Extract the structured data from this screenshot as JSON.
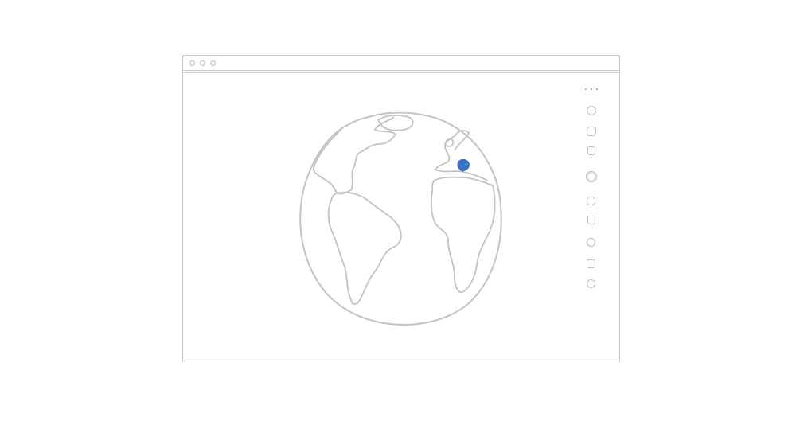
{
  "window": {
    "controls": [
      "close-dot",
      "minimize-dot",
      "maximize-dot"
    ]
  },
  "globe": {
    "icon": "globe-icon",
    "marker_color": "#3a74c4",
    "outline_color": "#c3c3c3"
  },
  "tools": {
    "menu_icon": "more-dots-icon",
    "buttons": [
      {
        "name": "tool-button-1",
        "icon": "circle-icon"
      },
      {
        "name": "tool-button-2",
        "icon": "rounded-square-icon"
      },
      {
        "name": "tool-button-3",
        "icon": "hexagon-icon"
      },
      {
        "name": "tool-button-4",
        "icon": "ring-icon"
      },
      {
        "name": "tool-button-5",
        "icon": "rounded-square-icon"
      },
      {
        "name": "tool-button-6",
        "icon": "rounded-square-icon"
      },
      {
        "name": "tool-button-7",
        "icon": "circle-icon"
      },
      {
        "name": "tool-button-8",
        "icon": "rounded-square-icon"
      },
      {
        "name": "tool-button-9",
        "icon": "circle-icon"
      }
    ]
  }
}
